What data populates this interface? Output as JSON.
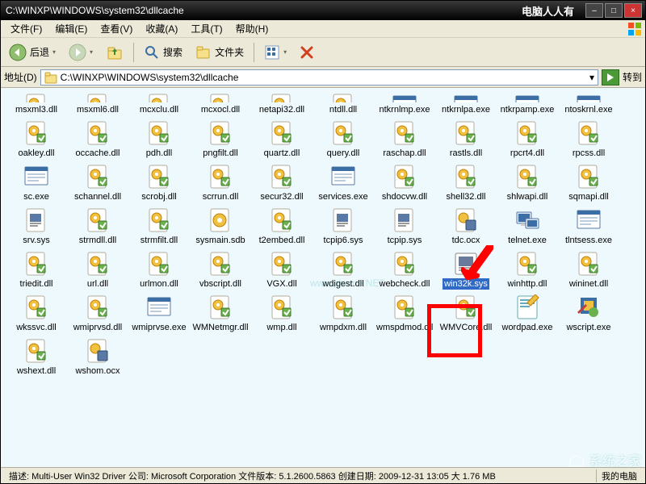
{
  "titlebar": {
    "path": "C:\\WINXP\\WINDOWS\\system32\\dllcache",
    "brand": "电脑人人有",
    "min": "–",
    "max": "□",
    "close": "×"
  },
  "menubar": {
    "file": "文件(F)",
    "edit": "编辑(E)",
    "view": "查看(V)",
    "fav": "收藏(A)",
    "tools": "工具(T)",
    "help": "帮助(H)"
  },
  "toolbar": {
    "back": "后退",
    "search": "搜索",
    "folders": "文件夹"
  },
  "addrbar": {
    "label": "地址(D)",
    "value": "C:\\WINXP\\WINDOWS\\system32\\dllcache",
    "go": "转到"
  },
  "icons": [
    {
      "n": "msxml3.dll",
      "t": "dll",
      "trunc": true
    },
    {
      "n": "msxml6.dll",
      "t": "dll",
      "trunc": true
    },
    {
      "n": "mcxclu.dll",
      "t": "dll",
      "trunc": true
    },
    {
      "n": "mcxocl.dll",
      "t": "dll",
      "trunc": true
    },
    {
      "n": "netapi32.dll",
      "t": "dll",
      "trunc": true
    },
    {
      "n": "ntdll.dll",
      "t": "dll",
      "trunc": true
    },
    {
      "n": "ntkrnlmp.exe",
      "t": "exe",
      "trunc": true
    },
    {
      "n": "ntkrnlpa.exe",
      "t": "exe",
      "trunc": true
    },
    {
      "n": "ntkrpamp.exe",
      "t": "exe",
      "trunc": true
    },
    {
      "n": "ntoskrnl.exe",
      "t": "exe",
      "trunc": true
    },
    {
      "n": "oakley.dll",
      "t": "dll"
    },
    {
      "n": "occache.dll",
      "t": "dll"
    },
    {
      "n": "pdh.dll",
      "t": "dll"
    },
    {
      "n": "pngfilt.dll",
      "t": "dll"
    },
    {
      "n": "quartz.dll",
      "t": "dll"
    },
    {
      "n": "query.dll",
      "t": "dll"
    },
    {
      "n": "raschap.dll",
      "t": "dll"
    },
    {
      "n": "rastls.dll",
      "t": "dll"
    },
    {
      "n": "rpcrt4.dll",
      "t": "dll"
    },
    {
      "n": "rpcss.dll",
      "t": "dll"
    },
    {
      "n": "sc.exe",
      "t": "exe"
    },
    {
      "n": "schannel.dll",
      "t": "dll"
    },
    {
      "n": "scrobj.dll",
      "t": "dll"
    },
    {
      "n": "scrrun.dll",
      "t": "dll"
    },
    {
      "n": "secur32.dll",
      "t": "dll"
    },
    {
      "n": "services.exe",
      "t": "exe"
    },
    {
      "n": "shdocvw.dll",
      "t": "dll"
    },
    {
      "n": "shell32.dll",
      "t": "dll"
    },
    {
      "n": "shlwapi.dll",
      "t": "dll"
    },
    {
      "n": "sqmapi.dll",
      "t": "dll"
    },
    {
      "n": "srv.sys",
      "t": "sys"
    },
    {
      "n": "strmdll.dll",
      "t": "dll"
    },
    {
      "n": "strmfilt.dll",
      "t": "dll"
    },
    {
      "n": "sysmain.sdb",
      "t": "sdb"
    },
    {
      "n": "t2embed.dll",
      "t": "dll"
    },
    {
      "n": "tcpip6.sys",
      "t": "sys"
    },
    {
      "n": "tcpip.sys",
      "t": "sys"
    },
    {
      "n": "tdc.ocx",
      "t": "ocx"
    },
    {
      "n": "telnet.exe",
      "t": "net"
    },
    {
      "n": "tlntsess.exe",
      "t": "exe"
    },
    {
      "n": "triedit.dll",
      "t": "dll"
    },
    {
      "n": "url.dll",
      "t": "dll"
    },
    {
      "n": "urlmon.dll",
      "t": "dll"
    },
    {
      "n": "vbscript.dll",
      "t": "dll"
    },
    {
      "n": "VGX.dll",
      "t": "dll"
    },
    {
      "n": "wdigest.dll",
      "t": "dll"
    },
    {
      "n": "webcheck.dll",
      "t": "dll"
    },
    {
      "n": "win32k.sys",
      "t": "syssel",
      "sel": true
    },
    {
      "n": "winhttp.dll",
      "t": "dll"
    },
    {
      "n": "wininet.dll",
      "t": "dll"
    },
    {
      "n": "wkssvc.dll",
      "t": "dll"
    },
    {
      "n": "wmiprvsd.dll",
      "t": "dll"
    },
    {
      "n": "wmiprvse.exe",
      "t": "exe"
    },
    {
      "n": "WMNetmgr.dll",
      "t": "dll"
    },
    {
      "n": "wmp.dll",
      "t": "dll"
    },
    {
      "n": "wmpdxm.dll",
      "t": "dll"
    },
    {
      "n": "wmspdmod.dll",
      "t": "dll"
    },
    {
      "n": "WMVCore.dll",
      "t": "dll"
    },
    {
      "n": "wordpad.exe",
      "t": "wordpad"
    },
    {
      "n": "wscript.exe",
      "t": "wscript"
    },
    {
      "n": "wshext.dll",
      "t": "dll"
    },
    {
      "n": "wshom.ocx",
      "t": "ocx"
    }
  ],
  "status": {
    "desc": "描述: Multi-User Win32 Driver 公司: Microsoft Corporation 文件版本: 5.1.2600.5863 创建日期: 2009-12-31 13:05 大 1.76 MB",
    "loc": "我的电脑"
  },
  "watermark": "系统之家",
  "watermark2": "www.phome.NET"
}
